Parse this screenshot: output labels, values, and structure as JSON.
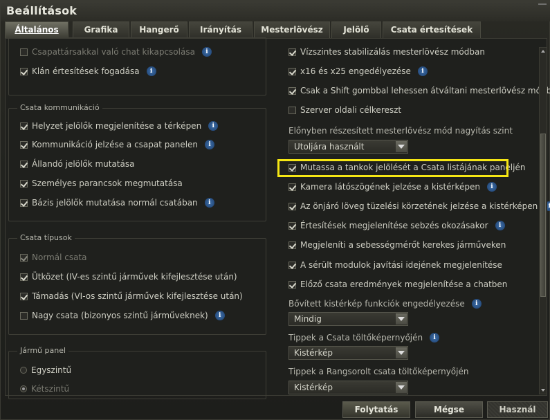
{
  "window": {
    "title": "Beállítások"
  },
  "tabs": [
    {
      "label": "Általános"
    },
    {
      "label": "Grafika"
    },
    {
      "label": "Hangerő"
    },
    {
      "label": "Irányítás"
    },
    {
      "label": "Mesterlövész"
    },
    {
      "label": "Jelölő"
    },
    {
      "label": "Csata értesítések"
    }
  ],
  "left": {
    "top_items": [
      {
        "label": "Csapattársakkal való chat kikapcsolása",
        "checked": false
      },
      {
        "label": "Klán értesítések fogadása",
        "checked": true
      }
    ],
    "battle_comm": {
      "title": "Csata kommunikáció",
      "items": [
        {
          "label": "Helyzet jelölők megjelenítése a térképen",
          "checked": true
        },
        {
          "label": "Kommunikáció jelzése a csapat panelen",
          "checked": true
        },
        {
          "label": "Állandó jelölők mutatása",
          "checked": true
        },
        {
          "label": "Személyes parancsok megmutatása",
          "checked": true
        },
        {
          "label": "Bázis jelölők mutatása normál csatában",
          "checked": true
        }
      ]
    },
    "battle_types": {
      "title": "Csata típusok",
      "items": [
        {
          "label": "Normál csata",
          "checked": true
        },
        {
          "label": "Ütközet (IV-es szintű járművek kifejlesztése után)",
          "checked": true
        },
        {
          "label": "Támadás (VI-os szintű járművek kifejlesztése után)",
          "checked": true
        },
        {
          "label": "Nagy csata (bizonyos szintű járműveknek)",
          "checked": false
        }
      ]
    },
    "vehicle_panel": {
      "title": "Jármű panel",
      "options": [
        {
          "label": "Egyszintű",
          "selected": false
        },
        {
          "label": "Kétszintű",
          "selected": true
        }
      ]
    }
  },
  "right": {
    "items_top": [
      {
        "label": "Vízszintes stabilizálás mesterlövész módban",
        "checked": true
      },
      {
        "label": "x16 és x25 engedélyezése",
        "checked": true
      },
      {
        "label": "Csak a Shift gombbal lehessen átváltani mesterlövész módba",
        "checked": true
      },
      {
        "label": "Szerver oldali célkereszt",
        "checked": false
      }
    ],
    "zoom_label": "Előnyben részesített mesterlövész mód nagyítás szint",
    "zoom_value": "Utoljára használt",
    "items_mid": [
      {
        "label": "Mutassa a tankok jelölését a Csata listájának paneljén",
        "checked": true
      },
      {
        "label": "Kamera látószögének jelzése a kistérképen",
        "checked": true
      },
      {
        "label": "Az önjáró löveg tüzelési körzetének jelzése a kistérképen",
        "checked": true
      },
      {
        "label": "Értesítések megjelenítése sebzés okozásakor",
        "checked": true
      },
      {
        "label": "Megjeleníti a sebességmérőt kerekes járműveken",
        "checked": true
      },
      {
        "label": "A sérült modulok javítási idejének megjelenítése",
        "checked": true
      },
      {
        "label": "Előző csata eredmények megjelenítése a chatben",
        "checked": true
      }
    ],
    "minimap_label": "Bővített kistérkép funkciók engedélyezése",
    "minimap_value": "Mindig",
    "tips_label": "Tippek a Csata töltőképernyőjén",
    "tips_value": "Kistérkép",
    "ranked_tips_label": "Tippek a Rangsorolt csata töltőképernyőjén",
    "ranked_tips_value": "Kistérkép"
  },
  "footer": {
    "continue": "Folytatás",
    "cancel": "Mégse",
    "apply": "Használ"
  },
  "info_glyph": "i",
  "colors": {
    "highlight": "#f5e614",
    "info_icon": "#2d5a93"
  }
}
